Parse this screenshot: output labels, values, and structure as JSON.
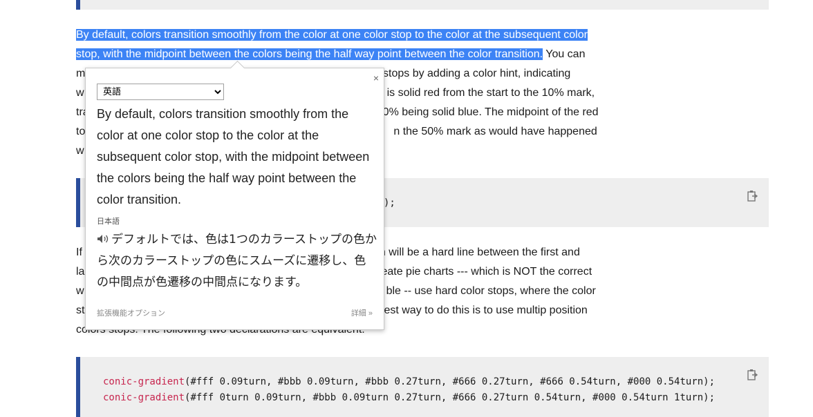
{
  "paragraph1": {
    "line1": "By default, colors transition smoothly from the color at one color stop to the color at the subsequent color",
    "line2_highlight": "stop, with the midpoint between the colors being the half way point between the color transition.",
    "line2_rest": " You can",
    "line3_start": "m",
    "line3_end": "or stops by adding a color hint, indicating",
    "line4_start": "w",
    "line4_end": "is solid red from the start to the 10% mark,",
    "line5_start": "tra",
    "line5_end": "0% being solid blue. The midpoint of the red",
    "line6_start": "to",
    "line6_end": "n the 50% mark as would have happened",
    "line7_start": "w"
  },
  "code_mid": ");",
  "paragraph2": {
    "line1_start": "If",
    "line1_end": "n will be a hard line between the first and",
    "line2_start": "la",
    "line2_end": "eate pie charts --- which is NOT the correct",
    "line3_start": "w",
    "line3_end": "ble -- use hard color stops, where the color",
    "line4_start": "st",
    "line4_end": "est way to do this is to use multip position",
    "line5": "colors stops. The following two declarations are equivalent:"
  },
  "code_bottom": {
    "line1_fn": "conic-gradient",
    "line1_args": "(#fff 0.09turn, #bbb 0.09turn, #bbb 0.27turn, #666 0.27turn, #666 0.54turn, #000 0.54turn);",
    "line2_fn": "conic-gradient",
    "line2_args": "(#fff 0turn 0.09turn, #bbb 0.09turn 0.27turn, #666 0.27turn 0.54turn, #000 0.54turn 1turn);"
  },
  "popup": {
    "close_label": "×",
    "source_language": "英語",
    "source_text": "By default, colors transition smoothly from the color at one color stop to the color at the subsequent color stop, with the midpoint between the colors being the half way point between the color transition.",
    "target_language": "日本語",
    "translation": "デフォルトでは、色は1つのカラーストップの色から次のカラーストップの色にスムーズに遷移し、色の中間点が色遷移の中間点になります。",
    "options_link": "拡張機能オプション",
    "details_link": "詳細 »",
    "speaker_icon": "speaker-icon"
  },
  "colors": {
    "highlight": "#3c83f5",
    "code_border": "#2a4d9c",
    "code_bg": "#eeeeee",
    "code_function": "#c7254e"
  }
}
